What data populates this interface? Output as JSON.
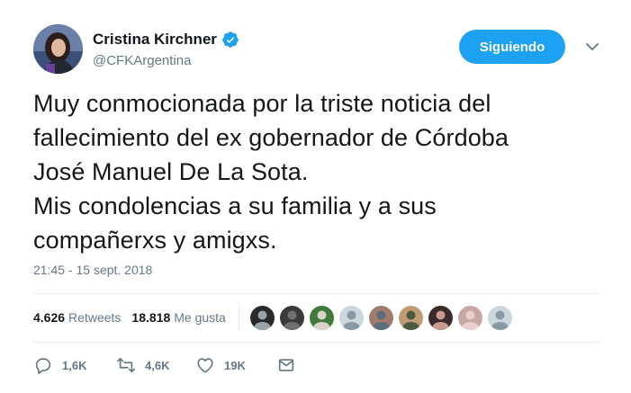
{
  "user": {
    "display_name": "Cristina Kirchner",
    "handle": "@CFKArgentina",
    "verified": true
  },
  "follow_button": {
    "label": "Siguiendo"
  },
  "tweet": {
    "text": "Muy conmocionada por la triste noticia del\nfallecimiento del ex gobernador de Córdoba\nJosé Manuel De La Sota.\nMis condolencias a su familia y a sus\ncompañerxs y amigxs.",
    "timestamp": "21:45 - 15 sept. 2018"
  },
  "stats": {
    "retweets_count": "4.626",
    "retweets_label": "Retweets",
    "likes_count": "18.818",
    "likes_label": "Me gusta"
  },
  "liker_avatars": [
    {
      "colors": [
        "#2a2a2a",
        "#9aa4a8"
      ]
    },
    {
      "colors": [
        "#3a3a3a",
        "#707070"
      ]
    },
    {
      "colors": [
        "#3f7a3a",
        "#d8d2c8"
      ]
    },
    {
      "colors": [
        "#ccd6dd",
        "#8899a6"
      ]
    },
    {
      "colors": [
        "#a07a6a",
        "#5b6d7a"
      ]
    },
    {
      "colors": [
        "#c09a70",
        "#4a5a40"
      ]
    },
    {
      "colors": [
        "#3a2a2a",
        "#c89a90"
      ]
    },
    {
      "colors": [
        "#c9a8a4",
        "#e8d0cc"
      ]
    },
    {
      "colors": [
        "#ccd6dd",
        "#8899a6"
      ]
    }
  ],
  "actions": {
    "reply_count": "1,6K",
    "retweet_count": "4,6K",
    "like_count": "19K"
  },
  "colors": {
    "accent": "#1da1f2",
    "secondary_text": "#657786",
    "divider": "#e6ecf0"
  }
}
